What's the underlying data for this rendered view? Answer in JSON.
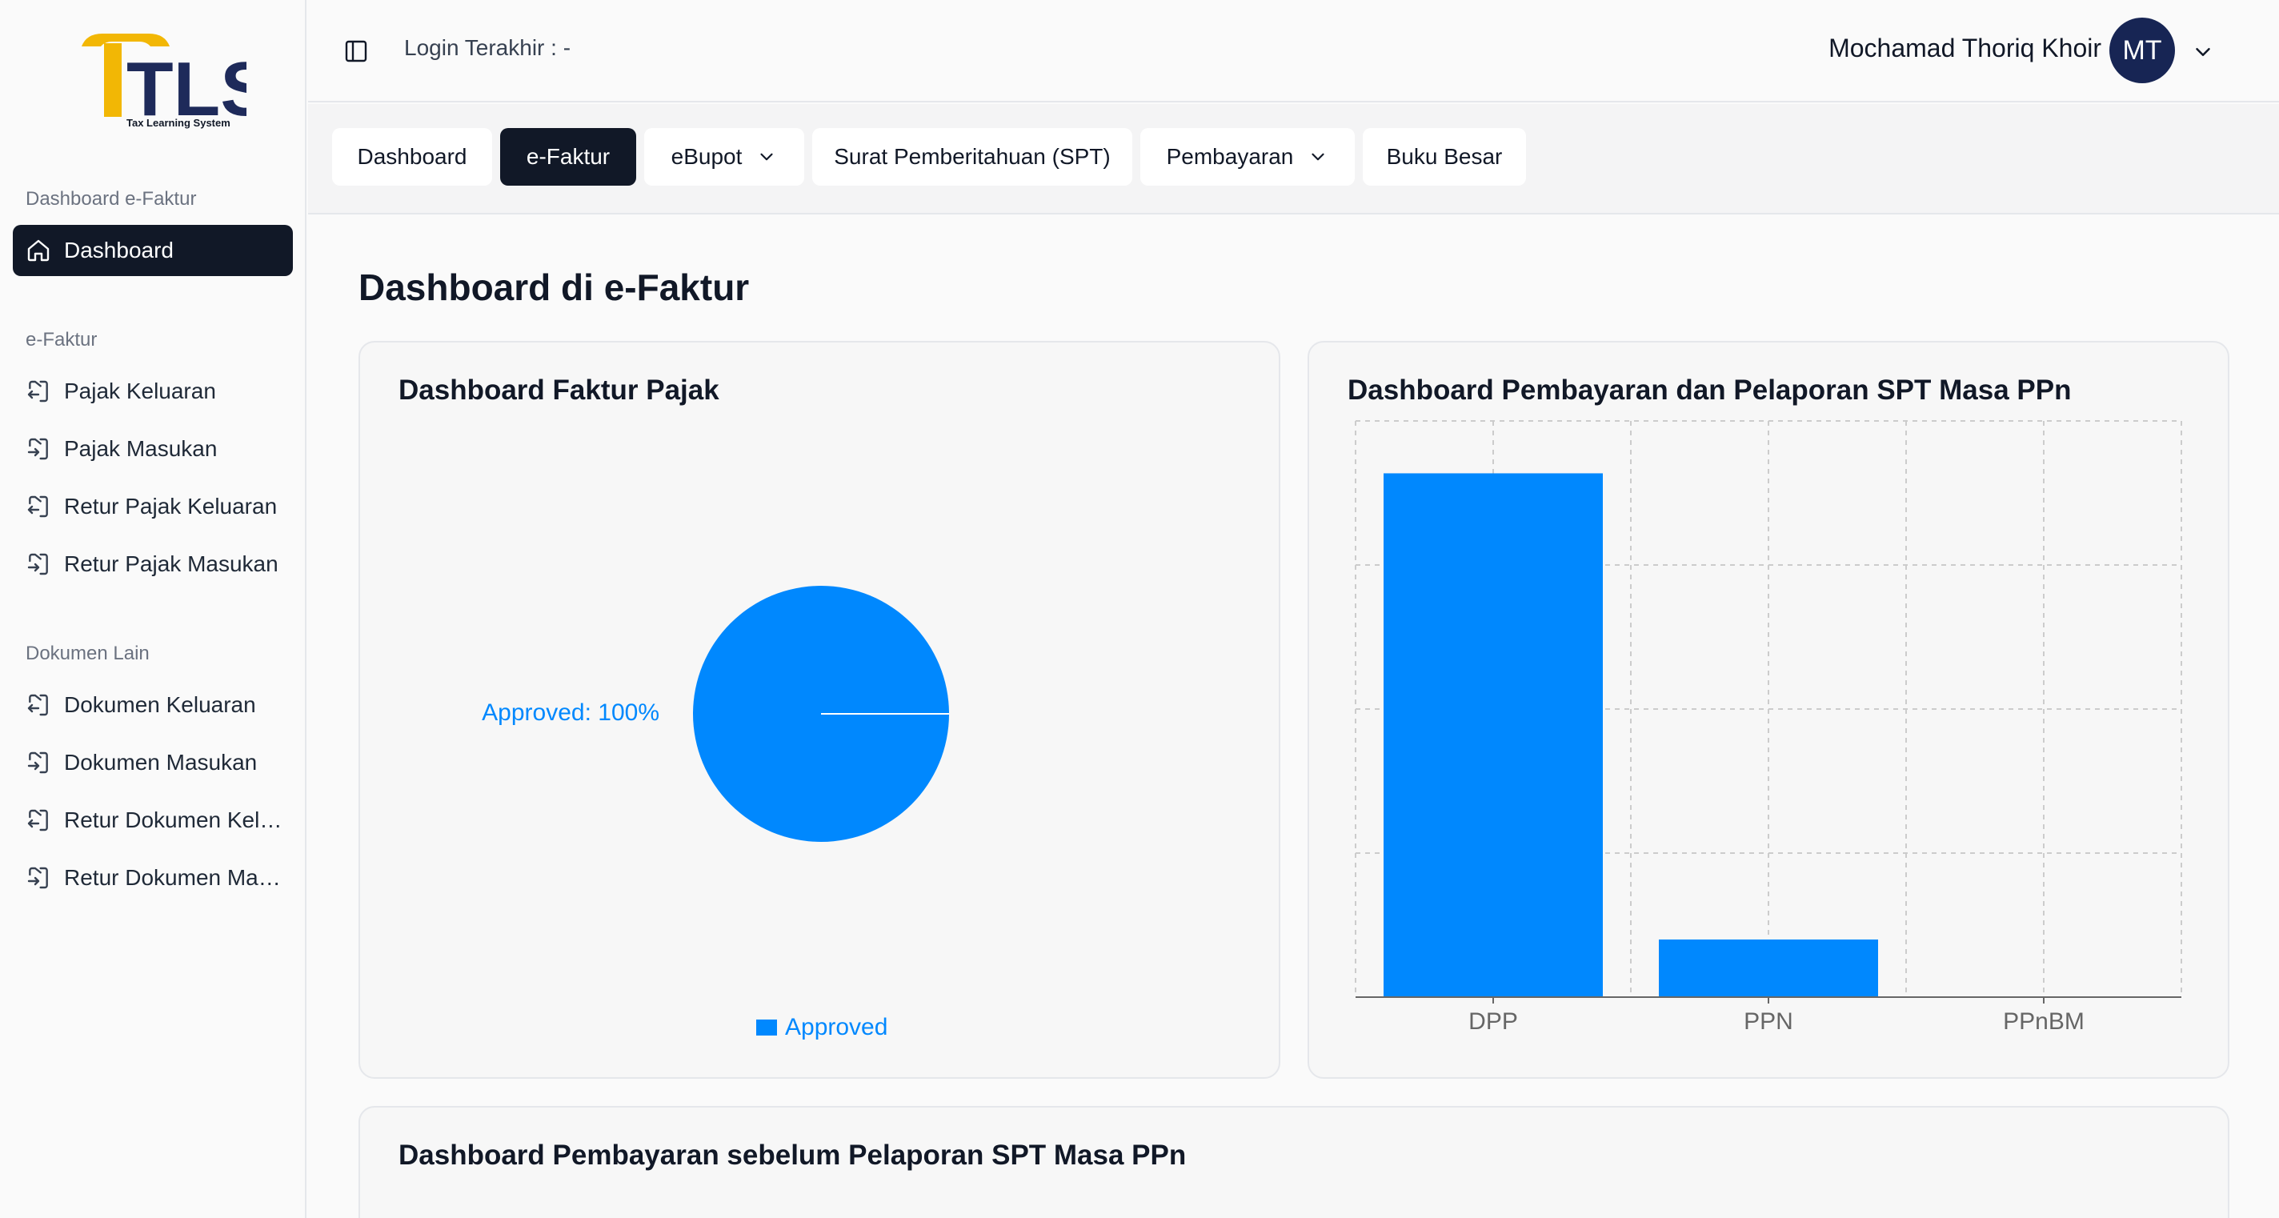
{
  "colors": {
    "accent": "#0088fe",
    "primary": "#111827",
    "avatar": "#172554",
    "logo_gold": "#f2b705",
    "logo_navy": "#1e2a5a"
  },
  "logo": {
    "letters": "TLS",
    "tagline": "Tax Learning System"
  },
  "sidebar": {
    "sections": [
      {
        "label": "Dashboard e-Faktur"
      },
      {
        "label": "e-Faktur"
      },
      {
        "label": "Dokumen Lain"
      }
    ],
    "items": [
      {
        "label": "Dashboard",
        "icon": "home-icon"
      },
      {
        "label": "Pajak Keluaran",
        "icon": "file-export-icon"
      },
      {
        "label": "Pajak Masukan",
        "icon": "file-import-icon"
      },
      {
        "label": "Retur Pajak Keluaran",
        "icon": "file-export-icon"
      },
      {
        "label": "Retur Pajak Masukan",
        "icon": "file-import-icon"
      },
      {
        "label": "Dokumen Keluaran",
        "icon": "file-export-icon"
      },
      {
        "label": "Dokumen Masukan",
        "icon": "file-import-icon"
      },
      {
        "label": "Retur Dokumen Keluaran",
        "icon": "file-export-icon"
      },
      {
        "label": "Retur Dokumen Masukan",
        "icon": "file-import-icon"
      }
    ]
  },
  "header": {
    "last_login": "Login Terakhir : -",
    "user_name": "Mochamad Thoriq Khoir",
    "avatar_initials": "MT"
  },
  "tabs": [
    {
      "label": "Dashboard"
    },
    {
      "label": "e-Faktur"
    },
    {
      "label": "eBupot"
    },
    {
      "label": "Surat Pemberitahuan (SPT)"
    },
    {
      "label": "Pembayaran"
    },
    {
      "label": "Buku Besar"
    }
  ],
  "main": {
    "title": "Dashboard di e-Faktur",
    "cards": [
      {
        "title": "Dashboard Faktur Pajak"
      },
      {
        "title": "Dashboard Pembayaran dan Pelaporan SPT Masa PPn"
      },
      {
        "title": "Dashboard Pembayaran sebelum Pelaporan SPT Masa PPn"
      }
    ]
  },
  "chart_data": [
    {
      "type": "pie",
      "title": "Dashboard Faktur Pajak",
      "slices": [
        {
          "name": "Approved",
          "value": 100
        }
      ],
      "slice_label": "Approved: 100%",
      "legend": [
        "Approved"
      ],
      "legend_position": "bottom"
    },
    {
      "type": "bar",
      "title": "Dashboard Pembayaran dan Pelaporan SPT Masa PPn",
      "categories": [
        "DPP",
        "PPN",
        "PPnBM"
      ],
      "values": [
        1.0,
        0.11,
        0
      ],
      "ylim": [
        0,
        1.1
      ],
      "grid": true
    }
  ]
}
